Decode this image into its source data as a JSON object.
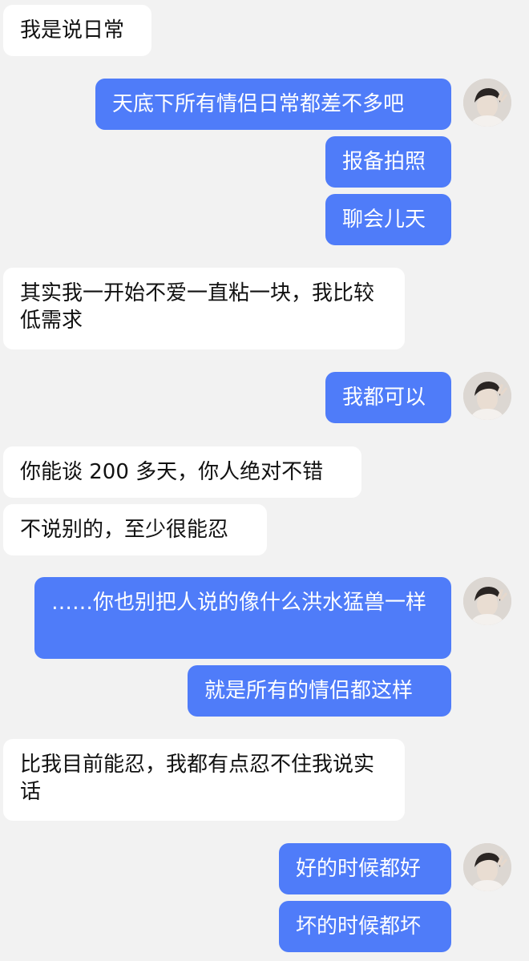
{
  "messages": {
    "m1": "我是说日常",
    "m2": "天底下所有情侣日常都差不多吧",
    "m3": "报备拍照",
    "m4": "聊会儿天",
    "m5": "其实我一开始不爱一直粘一块，我比较低需求",
    "m6": "我都可以",
    "m7": "你能谈 200 多天，你人绝对不错",
    "m8": "不说别的，至少很能忍",
    "m9": "……你也别把人说的像什么洪水猛兽一样",
    "m10": "就是所有的情侣都这样",
    "m11": "比我目前能忍，我都有点忍不住我说实话",
    "m12": "好的时候都好",
    "m13": "坏的时候都坏"
  },
  "colors": {
    "background": "#f2f2f2",
    "incoming_bubble": "#ffffff",
    "outgoing_bubble": "#4f7cf9",
    "incoming_text": "#111111",
    "outgoing_text": "#ffffff"
  },
  "icons": {
    "avatar": "user-avatar-icon"
  }
}
